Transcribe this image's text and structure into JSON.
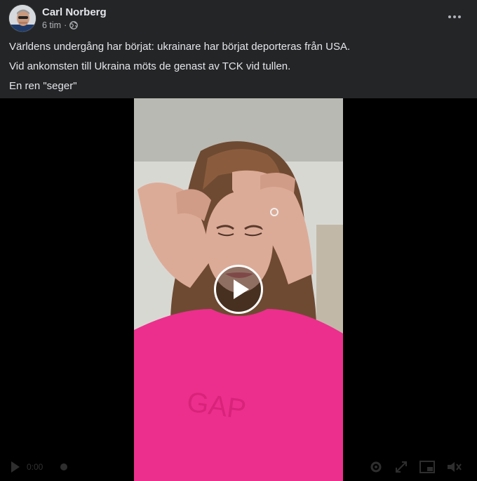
{
  "post": {
    "author": "Carl Norberg",
    "timestamp": "6 tim",
    "visibility_icon": "globe-icon",
    "more_icon": "more-options-icon",
    "lines": [
      "Världens undergång har börjat: ukrainare har börjat deporteras från USA.",
      "Vid ankomsten till Ukraina möts de genast av TCK vid tullen.",
      "En ren \"seger\""
    ]
  },
  "video": {
    "play_icon": "play-icon",
    "elapsed": "0:00",
    "progress": 0
  },
  "colors": {
    "background": "#242526",
    "primary_text": "#e4e6eb",
    "secondary_text": "#b0b3b8",
    "hoodie": "#ec2f8c"
  }
}
